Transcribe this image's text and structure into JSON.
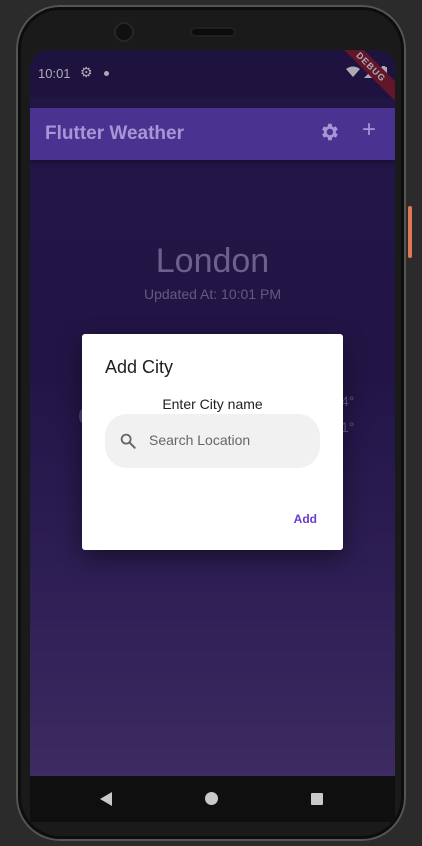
{
  "status_bar": {
    "time": "10:01",
    "debug_label": "DEBUG"
  },
  "app_bar": {
    "title": "Flutter Weather",
    "add_symbol": "+"
  },
  "weather": {
    "city": "London",
    "updated": "Updated At: 10:01 PM",
    "partial_temp_1": "4°",
    "partial_temp_2": "1°"
  },
  "dialog": {
    "title": "Add City",
    "prompt": "Enter City name",
    "search_placeholder": "Search Location",
    "add_label": "Add"
  },
  "colors": {
    "app_bar": "#4a3390",
    "accent": "#6a3bd1",
    "background_top": "#2a1c55",
    "background_bottom": "#533c80"
  },
  "icons": [
    "settings-icon",
    "add-icon",
    "search-icon",
    "back-icon",
    "home-icon",
    "recents-icon",
    "wifi-icon",
    "signal-icon",
    "battery-icon"
  ]
}
